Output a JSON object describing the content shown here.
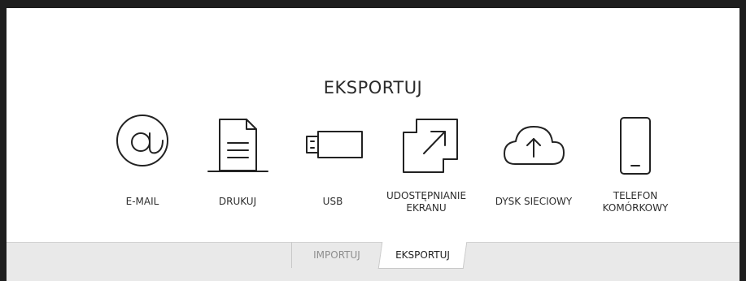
{
  "title": "EKSPORTUJ",
  "options": [
    {
      "icon": "at-sign-icon",
      "lines": [
        "E-MAIL"
      ]
    },
    {
      "icon": "printer-document-icon",
      "lines": [
        "DRUKUJ"
      ]
    },
    {
      "icon": "usb-drive-icon",
      "lines": [
        "USB"
      ]
    },
    {
      "icon": "screen-share-icon",
      "lines": [
        "UDOSTĘPNIANIE",
        "EKRANU"
      ]
    },
    {
      "icon": "cloud-upload-icon",
      "lines": [
        "DYSK SIECIOWY"
      ]
    },
    {
      "icon": "mobile-phone-icon",
      "lines": [
        "TELEFON",
        "KOMÓRKOWY"
      ]
    }
  ],
  "tabs": {
    "import_label": "IMPORTUJ",
    "export_label": "EKSPORTUJ",
    "active": "EKSPORTUJ"
  }
}
